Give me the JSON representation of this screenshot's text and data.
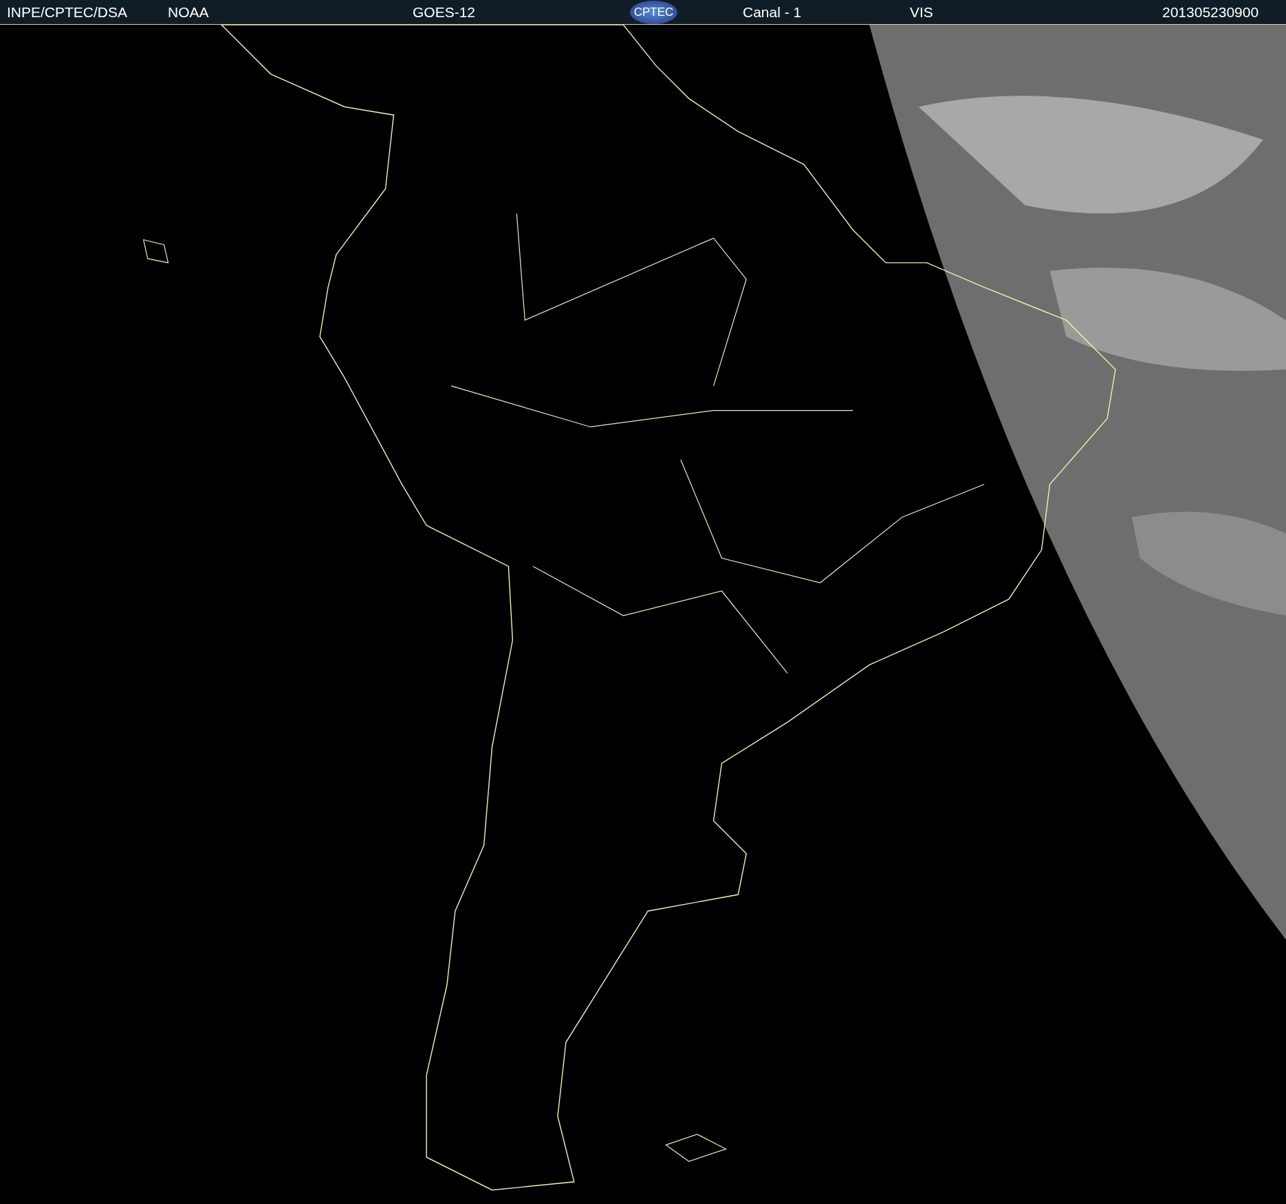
{
  "header": {
    "items": [
      {
        "kind": "text",
        "text": "INPE/CPTEC/DSA"
      },
      {
        "kind": "text",
        "text": "NOAA"
      },
      {
        "kind": "text",
        "text": "GOES-12"
      },
      {
        "kind": "logo",
        "text": "CPTEC"
      },
      {
        "kind": "text",
        "text": "Canal - 1"
      },
      {
        "kind": "text",
        "text": "VIS"
      },
      {
        "kind": "text",
        "text": "201305230900"
      }
    ]
  }
}
